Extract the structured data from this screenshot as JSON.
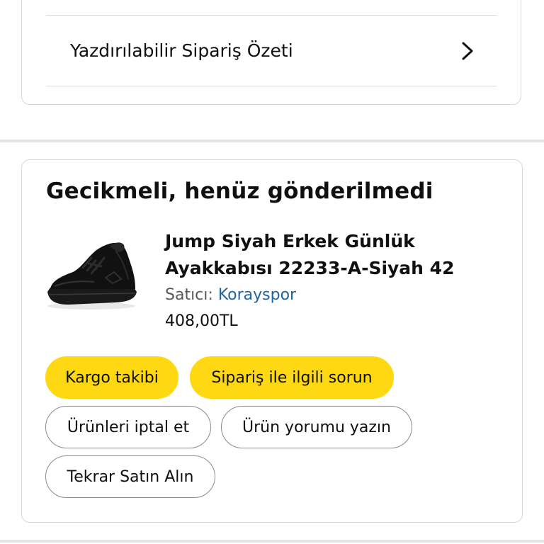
{
  "summary": {
    "label": "Yazdırılabilir Sipariş Özeti",
    "icon": "chevron-right-icon"
  },
  "order": {
    "status_title": "Gecikmeli, henüz gönderilmedi",
    "product": {
      "title_line1": "Jump Siyah Erkek Günlük",
      "title_line2": "Ayakkabısı 22233-A-Siyah 42",
      "seller_prefix": "Satıcı:",
      "seller_name": "Korayspor",
      "price": "408,00TL",
      "image": "black-sneaker-image"
    },
    "buttons": {
      "track": "Kargo takibi",
      "problem": "Sipariş ile ilgili sorun",
      "cancel": "Ürünleri iptal et",
      "review": "Ürün yorumu yazın",
      "buy_again": "Tekrar Satın Alın"
    }
  },
  "colors": {
    "primary_button": "#ffd814",
    "link": "#2162a1",
    "border": "#d5d9d9",
    "separator": "#e3e6e6"
  }
}
